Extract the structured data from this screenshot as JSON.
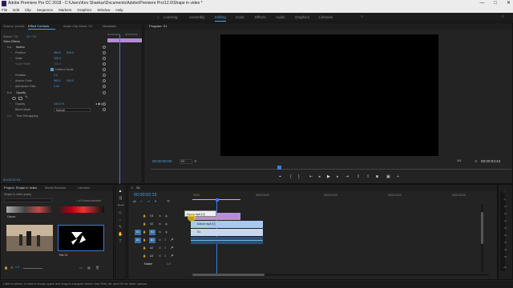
{
  "window": {
    "title": "Adobe Premiere Pro CC 2018 - C:\\Users\\Kev Shankar\\Documents\\Adobe\\Premiere Pro\\12.0\\Shape in video *",
    "controls": [
      "—",
      "□",
      "✕"
    ]
  },
  "menu": [
    "File",
    "Edit",
    "Clip",
    "Sequence",
    "Markers",
    "Graphics",
    "Window",
    "Help"
  ],
  "workspaces": [
    "Learning",
    "Assembly",
    "Editing",
    "Color",
    "Effects",
    "Audio",
    "Graphics",
    "Libraries"
  ],
  "active_workspace": "Editing",
  "source_panel": {
    "tabs": [
      "Source: (none)",
      "Effect Controls",
      "Audio Clip Mixer: S1",
      "Metadata"
    ],
    "active_tab": "Effect Controls",
    "master_label": "Master * S1",
    "sequence_label": "S1 * S1",
    "ruler_time": "00:00:00:00",
    "ruler_time_end": "00:00:05:00",
    "section_video_effects": "Video Effects",
    "motion": "Motion",
    "rows": [
      {
        "label": "Position",
        "v1": "960.0",
        "v2": "540.0"
      },
      {
        "label": "Scale",
        "v1": "100.0",
        "v2": ""
      },
      {
        "label": "Scale Width",
        "v1": "100.0",
        "v2": ""
      },
      {
        "label": "",
        "v1": "Uniform Scale",
        "v2": ""
      },
      {
        "label": "Rotation",
        "v1": "0.0",
        "v2": ""
      },
      {
        "label": "Anchor Point",
        "v1": "960.0",
        "v2": "540.0"
      },
      {
        "label": "Anti-flicker Filter",
        "v1": "0.00",
        "v2": ""
      }
    ],
    "opacity_section": "Opacity",
    "opacity_value": "100.0 %",
    "opacity_label": "Opacity",
    "blend_mode_label": "Blend Mode",
    "blend_mode": "Normal",
    "time_remapping": "Time Remapping",
    "current_time": "00:00:02:15"
  },
  "program_panel": {
    "tab": "Program: S1",
    "timecode": "00:00:00:00",
    "fit": "Fit",
    "quality": "1/4",
    "duration": "00:00:04:24"
  },
  "project_panel": {
    "tabs": [
      "Project: Shape in video",
      "Media Browser",
      "Libraries"
    ],
    "project_file": "Shape in video.prproj",
    "selection": "1 of 4 items selected",
    "items": [
      {
        "name": "Dance"
      },
      {
        "name": ""
      },
      {
        "name": ""
      },
      {
        "name": "Title 01"
      }
    ],
    "zoom_label": "1 0"
  },
  "timeline": {
    "tab": "S1",
    "timecode": "00:00:02:15",
    "ruler_labels": [
      "00:00",
      "00:00:05:00",
      "00:00:10:00",
      "00:00:15:00",
      "00:00:20:00"
    ],
    "tracks": [
      {
        "name": "V3",
        "kind": "video"
      },
      {
        "name": "V2",
        "kind": "video"
      },
      {
        "name": "V1",
        "kind": "video"
      },
      {
        "name": "A1",
        "kind": "audio"
      },
      {
        "name": "A2",
        "kind": "audio"
      },
      {
        "name": "A3",
        "kind": "audio"
      }
    ],
    "master_label": "Master",
    "master_value": "0.0",
    "clips": [
      {
        "name": "Title 01",
        "kind": "title"
      },
      {
        "name": "Dance.mp4 [V]",
        "kind": "video"
      },
      {
        "name": "S1",
        "kind": "nest"
      },
      {
        "name": "",
        "kind": "audio"
      }
    ],
    "tooltip": "Dance.mp4 [V]"
  },
  "vu_labels": [
    "0",
    "-6",
    "-12",
    "-18",
    "-24",
    "-30",
    "-36",
    "-42",
    "-48",
    "-54",
    "dB"
  ],
  "status_bar": "Click to select, or click in empty space and drag to marquee select. Use Shift, Alt, and Ctrl for other options.",
  "colors": {
    "accent": "#4f9bd8",
    "title_clip": "#b98cd9",
    "video_clip": "#a9c9f0",
    "audio_clip": "#6fb0d9",
    "playhead": "#3a7ad8"
  }
}
